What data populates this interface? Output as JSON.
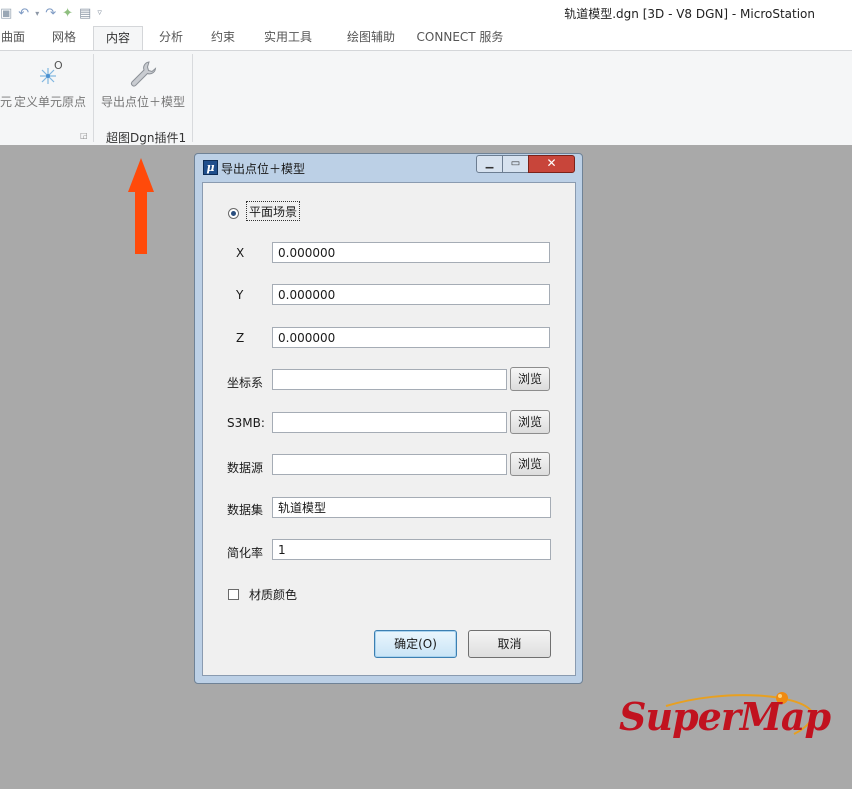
{
  "window": {
    "title": "轨道模型.dgn [3D - V8 DGN] - MicroStation"
  },
  "quick_access": [
    "save-icon",
    "undo-icon",
    "redo-icon",
    "pin-icon",
    "print-icon",
    "customize-icon"
  ],
  "ribbon": {
    "tabs": [
      "曲面",
      "网格",
      "内容",
      "分析",
      "约束",
      "实用工具",
      "绘图辅助",
      "CONNECT 服务"
    ],
    "active_tab": "内容",
    "partial_button_label": "元",
    "define_origin_label": "定义单元原点",
    "define_origin_icon": "cell-origin-icon",
    "export_button_label": "导出点位＋模型",
    "export_icon": "wrench-icon",
    "group_title": "超图Dgn插件1"
  },
  "dialog": {
    "title": "导出点位＋模型",
    "radio_label": "平面场景",
    "radio_checked": true,
    "x_label": "X",
    "x_value": "0.000000",
    "y_label": "Y",
    "y_value": "0.000000",
    "z_label": "Z",
    "z_value": "0.000000",
    "coord_label": "坐标系",
    "coord_value": "",
    "s3mb_label": "S3MB:",
    "s3mb_value": "",
    "datasource_label": "数据源",
    "datasource_value": "",
    "dataset_label": "数据集",
    "dataset_value": "轨道模型",
    "simplify_label": "简化率",
    "simplify_value": "1",
    "browse_label": "浏览",
    "material_label": "材质颜色",
    "material_checked": false,
    "ok_label": "确定(O)",
    "cancel_label": "取消"
  },
  "logo": {
    "text": "SuperMap"
  },
  "colors": {
    "arrow": "#ff4a0a",
    "logo": "#c1121f",
    "canvas": "#a9a9a9"
  }
}
